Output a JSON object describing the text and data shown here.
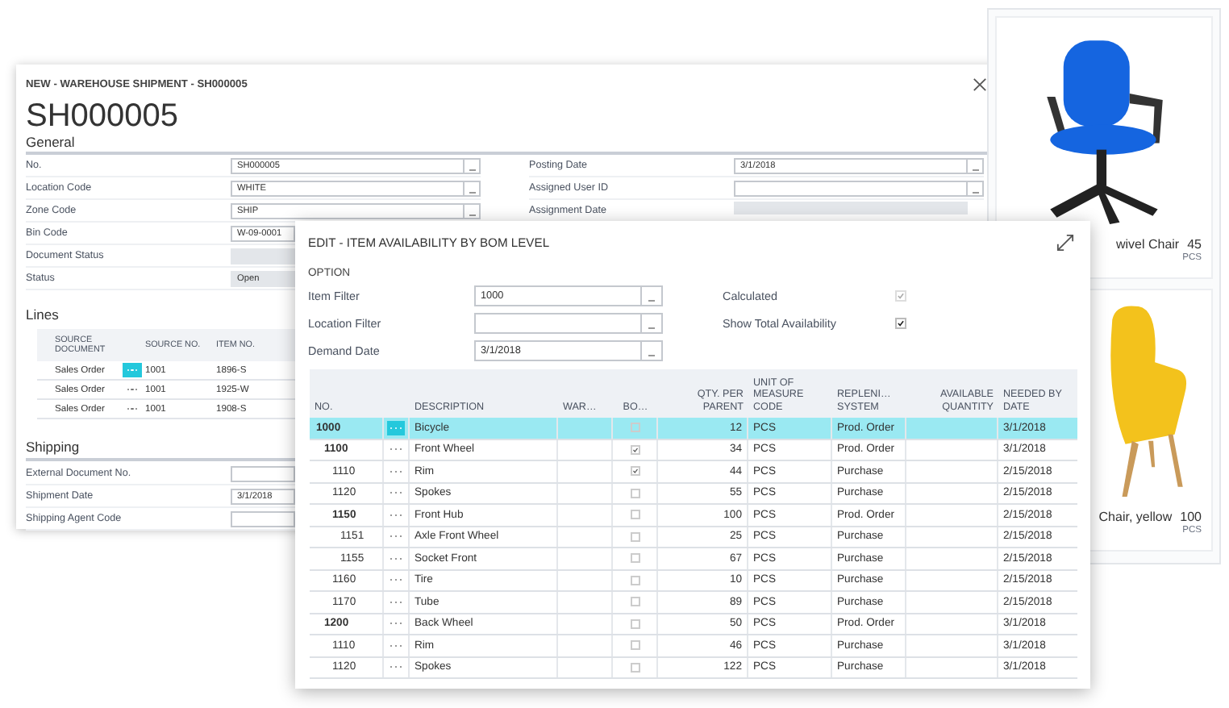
{
  "shipment_window": {
    "title": "NEW - WAREHOUSE SHIPMENT - SH000005",
    "heading": "SH000005",
    "general": {
      "heading": "General",
      "fields": [
        {
          "label": "No.",
          "value": "SH000005",
          "kind": "lookup"
        },
        {
          "label": "Location Code",
          "value": "WHITE",
          "kind": "lookup"
        },
        {
          "label": "Zone Code",
          "value": "SHIP",
          "kind": "lookup"
        },
        {
          "label": "Bin Code",
          "value": "W-09-0001",
          "kind": "text"
        },
        {
          "label": "Document Status",
          "kind": "readonly"
        },
        {
          "label": "Status",
          "value": "Open",
          "kind": "readonly"
        }
      ],
      "fields_right": [
        {
          "label": "Posting Date",
          "value": "3/1/2018",
          "kind": "lookup"
        },
        {
          "label": "Assigned User ID",
          "kind": "lookup"
        },
        {
          "label": "Assignment Date",
          "kind": "readonly"
        }
      ]
    },
    "lines": {
      "heading": "Lines",
      "columns": [
        "SOURCE DOCUMENT",
        "SOURCE NO.",
        "ITEM NO."
      ],
      "rows": [
        {
          "source_document": "Sales Order",
          "source_no": "1001",
          "item_no": "1896-S",
          "selected": true
        },
        {
          "source_document": "Sales Order",
          "source_no": "1001",
          "item_no": "1925-W",
          "selected": false
        },
        {
          "source_document": "Sales Order",
          "source_no": "1001",
          "item_no": "1908-S",
          "selected": false
        }
      ]
    },
    "shipping": {
      "heading": "Shipping",
      "fields": [
        {
          "label": "External Document No."
        },
        {
          "label": "Shipment Date",
          "value": "3/1/2018"
        },
        {
          "label": "Shipping Agent Code"
        }
      ]
    }
  },
  "item_cards": [
    {
      "name": "wivel Chair",
      "count": "45",
      "unit": "PCS"
    },
    {
      "name": "Chair, yellow",
      "count": "100",
      "unit": "PCS"
    }
  ],
  "availability_window": {
    "title": "EDIT - ITEM AVAILABILITY BY BOM LEVEL",
    "option_heading": "OPTION",
    "fields": [
      {
        "label": "Item Filter",
        "value": "1000"
      },
      {
        "label": "Location Filter"
      },
      {
        "label": "Demand Date",
        "value": "3/1/2018"
      }
    ],
    "toggles": [
      {
        "label": "Calculated",
        "checked": true,
        "disabled": true
      },
      {
        "label": "Show Total Availability",
        "checked": true,
        "disabled": false
      }
    ],
    "table": {
      "columns": [
        {
          "label": "NO.",
          "kind": "text"
        },
        {
          "label": "DESCRIPTION",
          "kind": "text"
        },
        {
          "label": "WAR…",
          "kind": "text"
        },
        {
          "label": "BO…",
          "kind": "check"
        },
        {
          "label": "QTY. PER PARENT",
          "kind": "number"
        },
        {
          "label": "UNIT OF MEASURE CODE",
          "kind": "text"
        },
        {
          "label": "REPLENI… SYSTEM",
          "kind": "text"
        },
        {
          "label": "AVAILABLE QUANTITY",
          "kind": "number"
        },
        {
          "label": "NEEDED BY DATE",
          "kind": "text"
        }
      ],
      "rows": [
        {
          "no": "1000",
          "description": "Bicycle",
          "bom": false,
          "qty": "12",
          "uom": "PCS",
          "replenishment": "Prod. Order",
          "needed": "3/1/2018",
          "selected": true,
          "children": [
            {
              "no": "1100",
              "description": "Front Wheel",
              "bom": true,
              "qty": "34",
              "uom": "PCS",
              "replenishment": "Prod. Order",
              "needed": "3/1/2018",
              "selected": false,
              "children": [
                {
                  "no": "1110",
                  "description": "Rim",
                  "bom": true,
                  "qty": "44",
                  "uom": "PCS",
                  "replenishment": "Purchase",
                  "needed": "2/15/2018",
                  "selected": false
                },
                {
                  "no": "1120",
                  "description": "Spokes",
                  "bom": false,
                  "qty": "55",
                  "uom": "PCS",
                  "replenishment": "Purchase",
                  "needed": "2/15/2018",
                  "selected": false
                },
                {
                  "no": "1150",
                  "description": "Front Hub",
                  "bom": false,
                  "qty": "100",
                  "uom": "PCS",
                  "replenishment": "Prod. Order",
                  "needed": "2/15/2018",
                  "selected": false,
                  "children": [
                    {
                      "no": "1151",
                      "description": "Axle Front Wheel",
                      "bom": false,
                      "qty": "25",
                      "uom": "PCS",
                      "replenishment": "Purchase",
                      "needed": "2/15/2018",
                      "selected": false
                    },
                    {
                      "no": "1155",
                      "description": "Socket Front",
                      "bom": false,
                      "qty": "67",
                      "uom": "PCS",
                      "replenishment": "Purchase",
                      "needed": "2/15/2018",
                      "selected": false
                    }
                  ]
                },
                {
                  "no": "1160",
                  "description": "Tire",
                  "bom": false,
                  "qty": "10",
                  "uom": "PCS",
                  "replenishment": "Purchase",
                  "needed": "2/15/2018",
                  "selected": false
                },
                {
                  "no": "1170",
                  "description": "Tube",
                  "bom": false,
                  "qty": "89",
                  "uom": "PCS",
                  "replenishment": "Purchase",
                  "needed": "2/15/2018",
                  "selected": false
                }
              ]
            },
            {
              "no": "1200",
              "description": "Back Wheel",
              "bom": false,
              "qty": "50",
              "uom": "PCS",
              "replenishment": "Prod. Order",
              "needed": "3/1/2018",
              "selected": false,
              "children": [
                {
                  "no": "1110",
                  "description": "Rim",
                  "bom": false,
                  "qty": "46",
                  "uom": "PCS",
                  "replenishment": "Purchase",
                  "needed": "3/1/2018",
                  "selected": false
                },
                {
                  "no": "1120",
                  "description": "Spokes",
                  "bom": false,
                  "qty": "122",
                  "uom": "PCS",
                  "replenishment": "Purchase",
                  "needed": "3/1/2018",
                  "selected": false
                }
              ]
            }
          ]
        }
      ]
    }
  }
}
